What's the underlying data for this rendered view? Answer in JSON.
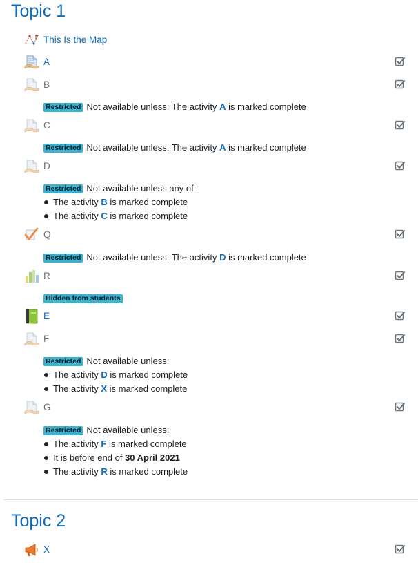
{
  "topics": [
    {
      "title": "Topic 1"
    },
    {
      "title": "Topic 2"
    }
  ],
  "common": {
    "restricted_badge": "Restricted",
    "hidden_badge": "Hidden from students",
    "not_available_unless": "Not available unless:",
    "not_available_unless_any": "Not available unless any of:",
    "not_available_unless_prefix": "Not available unless: The activity",
    "the_activity": "The activity",
    "is_marked_complete": "is marked complete",
    "it_is_before_end_of": "It is before end of"
  },
  "activities": {
    "map": {
      "name": "This Is the Map",
      "icon": "map-icon"
    },
    "a": {
      "name": "A",
      "icon": "page-icon"
    },
    "b": {
      "name": "B",
      "icon": "page-icon",
      "condition_ref": "A"
    },
    "c": {
      "name": "C",
      "icon": "page-icon",
      "condition_ref": "A"
    },
    "d": {
      "name": "D",
      "icon": "page-icon",
      "conditions": [
        "B",
        "C"
      ]
    },
    "q": {
      "name": "Q",
      "icon": "quiz-icon",
      "condition_ref": "D"
    },
    "r": {
      "name": "R",
      "icon": "chart-icon"
    },
    "e": {
      "name": "E",
      "icon": "book-icon"
    },
    "f": {
      "name": "F",
      "icon": "page-icon",
      "conditions": [
        "D",
        "X"
      ]
    },
    "g": {
      "name": "G",
      "icon": "page-icon",
      "conditions": [
        "F",
        "R"
      ],
      "date": "30 April 2021"
    },
    "x": {
      "name": "X",
      "icon": "megaphone-icon"
    }
  },
  "colors": {
    "link": "#0f6cbf",
    "badge": "#3bb3d0",
    "dimmed": "#6a737b"
  }
}
